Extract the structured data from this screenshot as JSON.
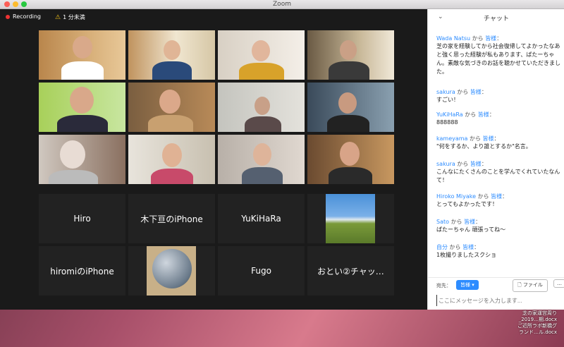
{
  "window": {
    "title": "Zoom"
  },
  "status": {
    "recording": "Recording",
    "warning": "1 分未満"
  },
  "tiles": [
    {
      "type": "video",
      "name": "participant-video-1"
    },
    {
      "type": "video",
      "name": "participant-video-2"
    },
    {
      "type": "video",
      "name": "participant-video-3"
    },
    {
      "type": "video",
      "name": "participant-video-4"
    },
    {
      "type": "video",
      "name": "participant-video-5"
    },
    {
      "type": "video",
      "name": "participant-video-6"
    },
    {
      "type": "video",
      "name": "participant-video-7"
    },
    {
      "type": "video",
      "name": "participant-video-8"
    },
    {
      "type": "video",
      "name": "participant-video-9"
    },
    {
      "type": "video",
      "name": "participant-video-10"
    },
    {
      "type": "video",
      "name": "participant-video-11"
    },
    {
      "type": "video",
      "name": "participant-video-12"
    },
    {
      "type": "label",
      "label": "Hiro"
    },
    {
      "type": "label",
      "label": "木下亘のiPhone"
    },
    {
      "type": "label",
      "label": "YuKiHaRa"
    },
    {
      "type": "image",
      "name": "landscape-avatar"
    },
    {
      "type": "label",
      "label": "hiromiのiPhone"
    },
    {
      "type": "image",
      "name": "globe-avatar"
    },
    {
      "type": "label",
      "label": "Fugo"
    },
    {
      "type": "label",
      "label": "おとい②チャッ…"
    }
  ],
  "chat": {
    "title": "チャット",
    "messages": [
      {
        "sender": "Wada Natsu",
        "kara": "から",
        "to": "皆様",
        "text": "芝の家を経験してから社会復帰してよかったなあと強く思った経験が私もあります、ぱたーちゃん。素敵な気づきのお話を聴かせていただきました。"
      },
      {
        "sender": "sakura",
        "kara": "から",
        "to": "皆様",
        "text": "すごい！"
      },
      {
        "sender": "YuKiHaRa",
        "kara": "から",
        "to": "皆様",
        "text": "888888"
      },
      {
        "sender": "kameyama",
        "kara": "から",
        "to": "皆様",
        "text": "\"何をするか、より誰とするか\"名言。"
      },
      {
        "sender": "sakura",
        "kara": "から",
        "to": "皆様",
        "text": "こんなにたくさんのことを学んでくれていたなんて！"
      },
      {
        "sender": "Hiroko Miyake",
        "kara": "から",
        "to": "皆様",
        "text": "とってもよかったです！"
      },
      {
        "sender": "Sato",
        "kara": "から",
        "to": "皆様",
        "text": "ぱたーちゃん 頑張ってね〜"
      },
      {
        "sender": "自分",
        "kara": "から",
        "to": "皆様",
        "text": "1枚撮りましたスクショ"
      }
    ],
    "to_label": "宛先：",
    "to_value": "皆様",
    "file_button": "ファイル",
    "more_button": "…",
    "input_placeholder": "ここにメッセージを入力します..."
  },
  "desktop_files": [
    "芝の家運営周り",
    "_2019…期.docx",
    "ご近所ラボ新橋グ",
    "ランド…ル.docx"
  ]
}
